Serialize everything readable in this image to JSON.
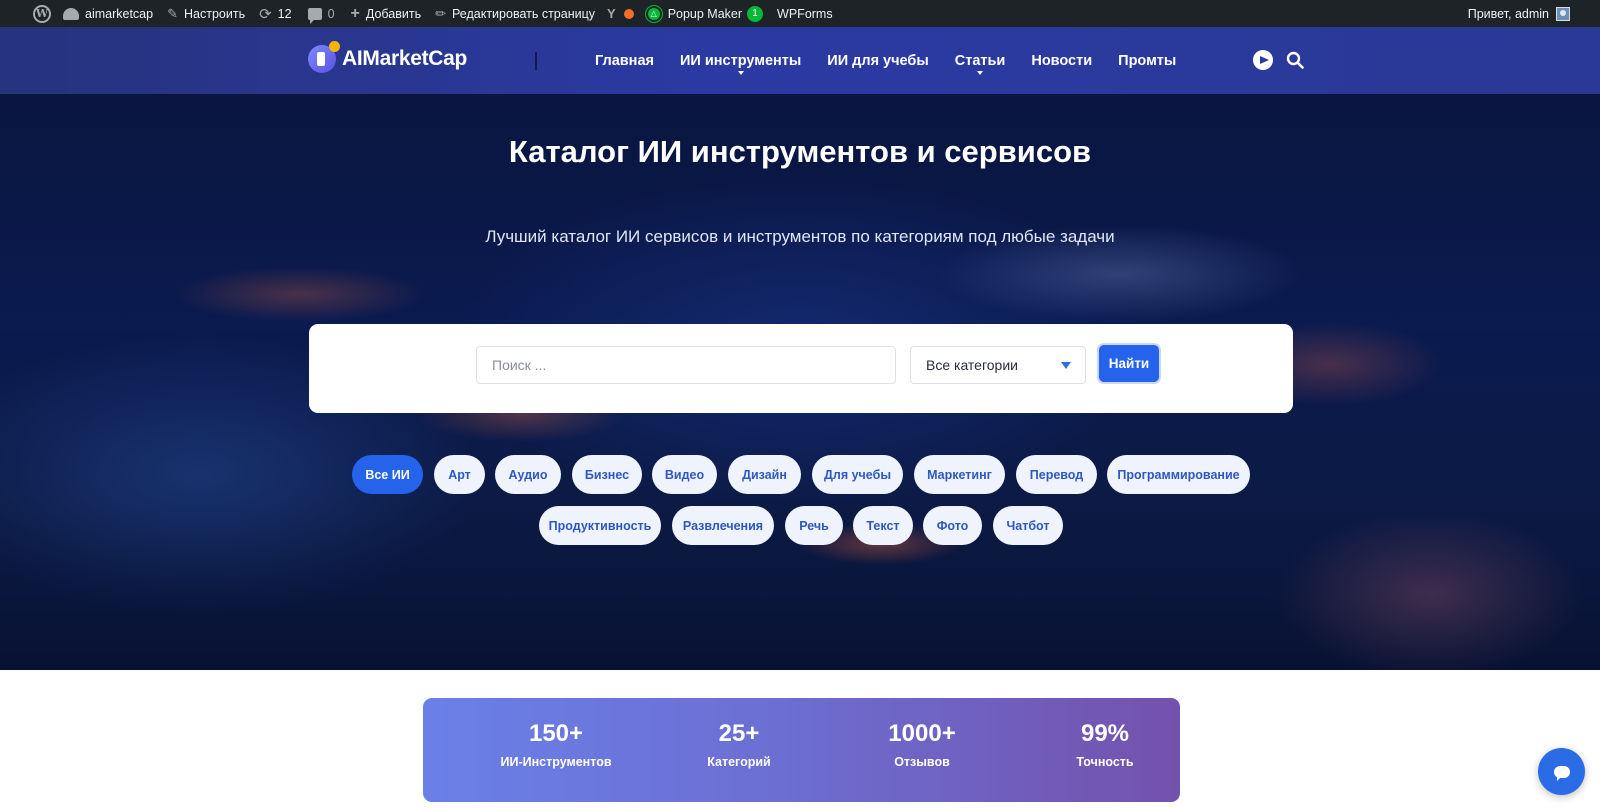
{
  "admin_bar": {
    "site_name": "aimarketcap",
    "customize": "Настроить",
    "updates_count": "12",
    "comments_count": "0",
    "add_new": "Добавить",
    "edit_page": "Редактировать страницу",
    "popup_maker": "Popup Maker",
    "popup_badge": "1",
    "wpforms": "WPForms",
    "greeting": "Привет, admin"
  },
  "header": {
    "logo_text": "AIMarketCap",
    "nav": [
      "Главная",
      "ИИ инструменты",
      "ИИ для учебы",
      "Статьи",
      "Новости",
      "Промты"
    ]
  },
  "hero": {
    "title": "Каталог ИИ инструментов и сервисов",
    "subtitle": "Лучший каталог ИИ сервисов и инструментов по категориям под любые задачи"
  },
  "search": {
    "placeholder": "Поиск ...",
    "category_selected": "Все категории",
    "button": "Найти"
  },
  "categories": {
    "row1": [
      "Все ИИ",
      "Арт",
      "Аудио",
      "Бизнес",
      "Видео",
      "Дизайн",
      "Для учебы",
      "Маркетинг",
      "Перевод",
      "Программирование"
    ],
    "row2": [
      "Продуктивность",
      "Развлечения",
      "Речь",
      "Текст",
      "Фото",
      "Чатбот"
    ],
    "active": "Все ИИ"
  },
  "stats": [
    {
      "value": "150+",
      "label": "ИИ-Инструментов"
    },
    {
      "value": "25+",
      "label": "Категорий"
    },
    {
      "value": "1000+",
      "label": "Отзывов"
    },
    {
      "value": "99%",
      "label": "Точность"
    }
  ],
  "colors": {
    "accent": "#2563eb",
    "admin_bar": "#1d2327",
    "header": "#2b3aa3"
  },
  "icons": [
    "wordpress-icon",
    "dashboard-icon",
    "brush-icon",
    "refresh-icon",
    "comment-icon",
    "plus-icon",
    "pencil-icon",
    "yoast-icon",
    "popup-maker-icon",
    "telegram-icon",
    "search-icon",
    "chat-icon"
  ]
}
